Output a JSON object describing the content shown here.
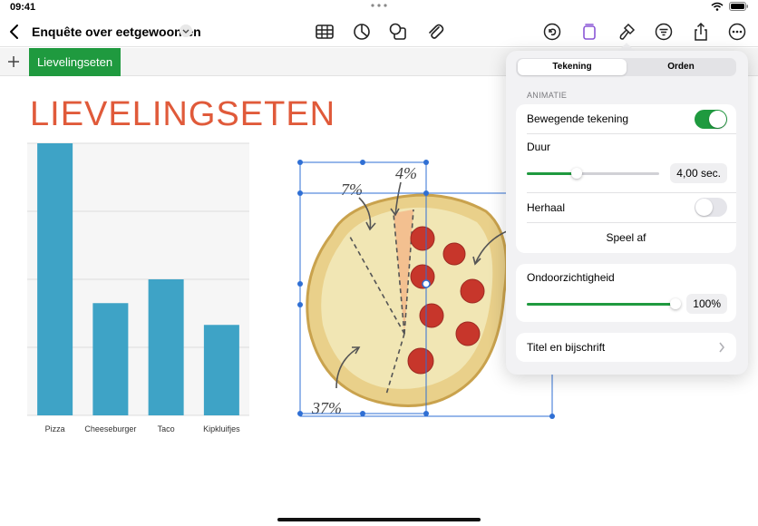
{
  "status": {
    "time": "09:41",
    "battery": "battery-icon",
    "wifi": "wifi-icon"
  },
  "toolbar": {
    "title": "Enquête over eetgewoonten",
    "icons": [
      "back-chevron-icon",
      "table-icon",
      "chart-icon",
      "shapes-icon",
      "paperclip-icon",
      "undo-icon",
      "clipboard-icon",
      "format-brush-icon",
      "filter-icon",
      "share-icon",
      "more-icon"
    ]
  },
  "sheets": {
    "active_tab": "Lievelingseten"
  },
  "document": {
    "heading": "LIEVELINGSETEN"
  },
  "chart_data": {
    "type": "bar",
    "categories": [
      "Pizza",
      "Cheeseburger",
      "Taco",
      "Kipkluifjes"
    ],
    "values": [
      40,
      16.5,
      20,
      13.3
    ],
    "ylim": [
      0,
      40
    ],
    "grid": true,
    "color": "#3ea3c6"
  },
  "pizza": {
    "labels": [
      "7%",
      "4%",
      "37%"
    ]
  },
  "panel": {
    "tabs": [
      "Tekening",
      "Orden"
    ],
    "section": "ANIMATIE",
    "animated_drawing": {
      "label": "Bewegende tekening",
      "on": true
    },
    "duration": {
      "label": "Duur",
      "value": "4,00 sec.",
      "fraction": 0.38
    },
    "repeat": {
      "label": "Herhaal",
      "on": false
    },
    "play": "Speel af",
    "opacity": {
      "label": "Ondoorzichtigheid",
      "value": "100%",
      "fraction": 1.0
    },
    "caption": "Titel en bijschrift"
  },
  "colors": {
    "accent": "#1f9a3f",
    "heading": "#e05a3a",
    "bar": "#3ea3c6"
  }
}
